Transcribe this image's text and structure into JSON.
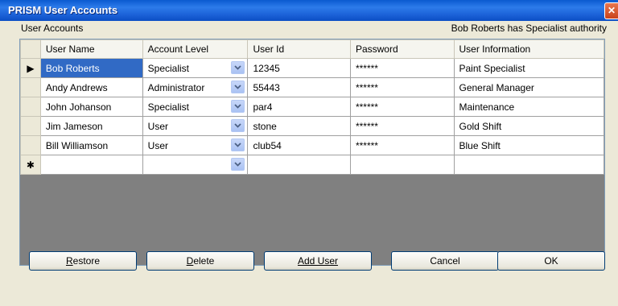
{
  "window": {
    "title": "PRISM User Accounts",
    "close_icon": "close-icon"
  },
  "group": {
    "label": "User Accounts",
    "authority_text": "Bob Roberts has Specialist authority"
  },
  "grid": {
    "columns": [
      "User Name",
      "Account Level",
      "User Id",
      "Password",
      "User Information"
    ],
    "rows": [
      {
        "marker": "▶",
        "name": "Bob Roberts",
        "level": "Specialist",
        "id": "12345",
        "password": "******",
        "info": "Paint Specialist"
      },
      {
        "marker": "",
        "name": "Andy Andrews",
        "level": "Administrator",
        "id": "55443",
        "password": "******",
        "info": "General Manager"
      },
      {
        "marker": "",
        "name": "John Johanson",
        "level": "Specialist",
        "id": "par4",
        "password": "******",
        "info": "Maintenance"
      },
      {
        "marker": "",
        "name": "Jim Jameson",
        "level": "User",
        "id": "stone",
        "password": "******",
        "info": "Gold Shift"
      },
      {
        "marker": "",
        "name": "Bill Williamson",
        "level": "User",
        "id": "club54",
        "password": "******",
        "info": "Blue Shift"
      }
    ],
    "new_row_marker": "✱"
  },
  "buttons": {
    "restore": {
      "label_first": "R",
      "label_rest": "estore"
    },
    "delete": {
      "label_first": "D",
      "label_rest": "elete"
    },
    "add_user": {
      "label_first": "A",
      "label_rest": "dd User"
    },
    "cancel": {
      "label": "Cancel"
    },
    "ok": {
      "label": "OK"
    }
  },
  "colors": {
    "titlebar": "#0a5ad0",
    "selection": "#316ac5",
    "grid_background": "#808080"
  }
}
